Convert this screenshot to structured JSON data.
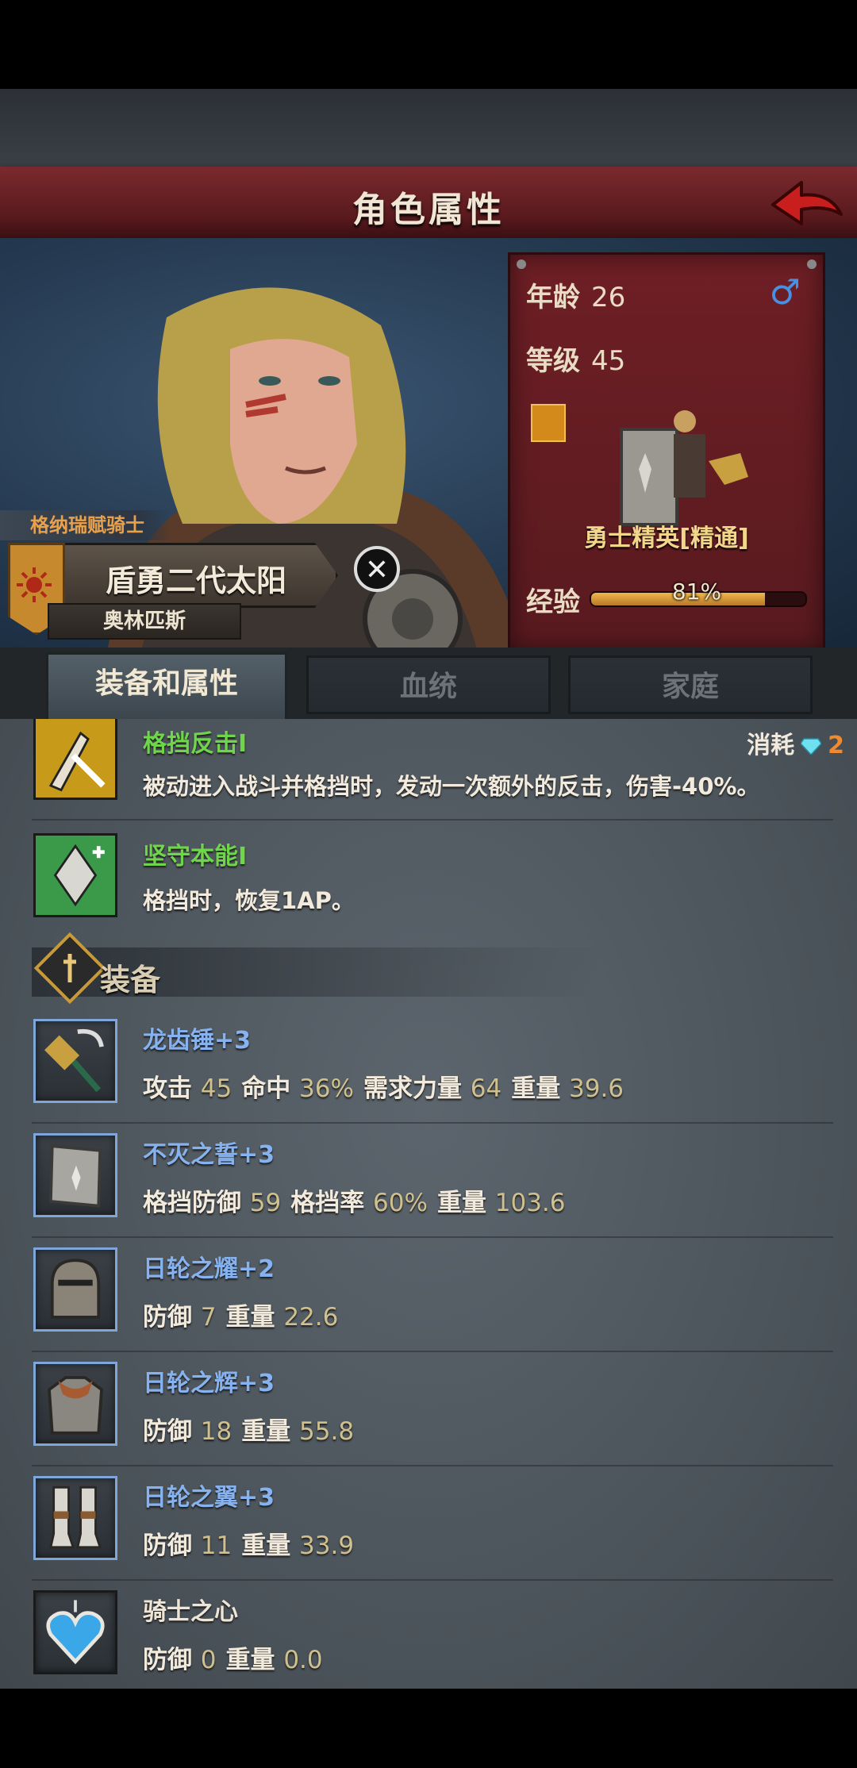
{
  "header": {
    "title": "角色属性"
  },
  "character": {
    "faction": "格纳瑞赋骑士",
    "name": "盾勇二代太阳",
    "location": "奥林匹斯",
    "age_label": "年龄",
    "age": "26",
    "gender_symbol": "♂",
    "level_label": "等级",
    "level": "45",
    "class_name": "勇士精英[精通]",
    "exp_label": "经验",
    "exp_text": "81%",
    "exp_fraction": 0.81
  },
  "tabs": [
    {
      "label": "装备和属性",
      "active": true
    },
    {
      "label": "血统",
      "active": false
    },
    {
      "label": "家庭",
      "active": false
    }
  ],
  "skills": [
    {
      "name": "格挡反击I",
      "desc": "被动进入战斗并格挡时，发动一次额外的反击，伤害-40%。",
      "cost_label": "消耗",
      "cost": "2"
    },
    {
      "name": "坚守本能I",
      "desc": "格挡时，恢复1AP。"
    }
  ],
  "equipment_section": {
    "title": "装备"
  },
  "equipment": [
    {
      "name": "龙齿锤+3",
      "stats": [
        {
          "label": "攻击",
          "value": "45"
        },
        {
          "label": "命中",
          "value": "36%"
        },
        {
          "label": "需求力量",
          "value": "64"
        },
        {
          "label": "重量",
          "value": "39.6"
        }
      ]
    },
    {
      "name": "不灭之誓+3",
      "stats": [
        {
          "label": "格挡防御",
          "value": "59"
        },
        {
          "label": "格挡率",
          "value": "60%"
        },
        {
          "label": "重量",
          "value": "103.6"
        }
      ]
    },
    {
      "name": "日轮之耀+2",
      "stats": [
        {
          "label": "防御",
          "value": "7"
        },
        {
          "label": "重量",
          "value": "22.6"
        }
      ]
    },
    {
      "name": "日轮之辉+3",
      "stats": [
        {
          "label": "防御",
          "value": "18"
        },
        {
          "label": "重量",
          "value": "55.8"
        }
      ]
    },
    {
      "name": "日轮之翼+3",
      "stats": [
        {
          "label": "防御",
          "value": "11"
        },
        {
          "label": "重量",
          "value": "33.9"
        }
      ]
    },
    {
      "name": "骑士之心",
      "stats": [
        {
          "label": "防御",
          "value": "0"
        },
        {
          "label": "重量",
          "value": "0.0"
        }
      ]
    }
  ]
}
